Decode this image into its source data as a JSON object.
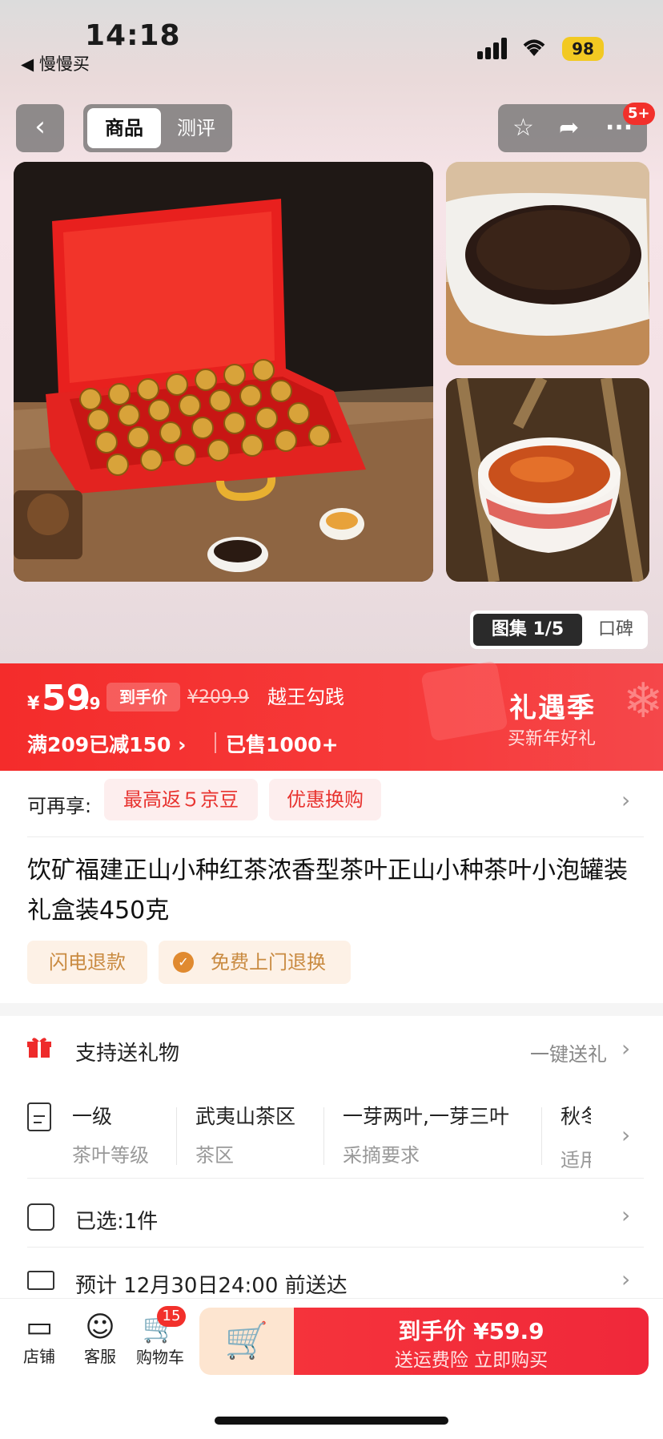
{
  "status_bar": {
    "time": "14:18",
    "back_app": "◀ 慢慢买",
    "battery": "98"
  },
  "header": {
    "tab_product": "商品",
    "tab_review": "测评",
    "more_badge": "5+"
  },
  "gallery": {
    "counter_label": "图集 1/5",
    "reviews_label": "口碑"
  },
  "price": {
    "currency": "¥",
    "integer": "59",
    "decimal": ".9",
    "hand_price_tag": "到手价",
    "original_price": "¥209.9",
    "brand": "越王勾践",
    "promo": "满209已减150 ›",
    "sold": "已售1000+",
    "season_title": "礼遇季",
    "season_sub": "买新年好礼"
  },
  "enjoy": {
    "label": "可再享:",
    "chips": [
      "最高返５京豆",
      "优惠换购"
    ]
  },
  "product": {
    "title": "饮矿福建正山小种红茶浓香型茶叶正山小种茶叶小泡罐装礼盒装450克",
    "services": [
      "闪电退款",
      "免费上门退换"
    ]
  },
  "gift_row": {
    "label": "支持送礼物",
    "action": "一键送礼"
  },
  "attributes": [
    {
      "value": "一级",
      "key": "茶叶等级"
    },
    {
      "value": "武夷山茶区",
      "key": "茶区"
    },
    {
      "value": "一芽两叶,一芽三叶",
      "key": "采摘要求"
    },
    {
      "value": "秋冬",
      "key": "适用"
    }
  ],
  "selected_row": {
    "label": "已选:",
    "value": "1件"
  },
  "delivery_row": {
    "text": "预计 12月30日24:00 前送达"
  },
  "bottom_bar": {
    "store": "店铺",
    "service": "客服",
    "cart": "购物车",
    "cart_count": "15",
    "buy_line1_label": "到手价",
    "buy_line1_price": "¥59.9",
    "buy_line2": "送运费险 立即购买"
  },
  "colors": {
    "accent_red": "#f42c2b",
    "chip_bg": "#fdeeee",
    "service_bg": "#fdf1e6",
    "cart_btn_bg": "#fde5d0"
  }
}
